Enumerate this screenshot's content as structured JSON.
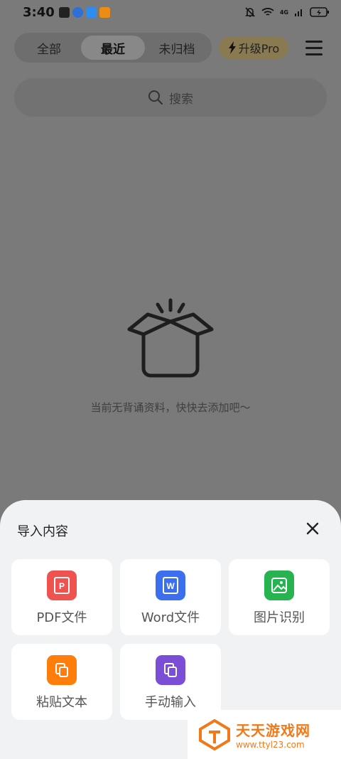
{
  "status_bar": {
    "time": "3:40",
    "network": "4G",
    "icons": [
      "qq-icon",
      "location-icon",
      "cloud-icon",
      "video-app-icon",
      "mute-bell-icon",
      "wifi-icon",
      "signal-icon",
      "battery-icon"
    ]
  },
  "tabs": [
    {
      "label": "全部",
      "active": false
    },
    {
      "label": "最近",
      "active": true
    },
    {
      "label": "未归档",
      "active": false
    }
  ],
  "upgrade_label": "升级Pro",
  "search": {
    "placeholder": "搜索"
  },
  "empty_state": {
    "message": "当前无背诵资料，快快去添加吧～"
  },
  "sheet": {
    "title": "导入内容",
    "options": [
      {
        "label": "PDF文件",
        "icon": "pdf-icon",
        "color": "#ef5350"
      },
      {
        "label": "Word文件",
        "icon": "word-icon",
        "color": "#3b6ff0"
      },
      {
        "label": "图片识别",
        "icon": "image-icon",
        "color": "#27b34f"
      },
      {
        "label": "粘贴文本",
        "icon": "paste-icon",
        "color": "#ff7d0a"
      },
      {
        "label": "手动输入",
        "icon": "copy-icon",
        "color": "#7a4fd6"
      }
    ]
  },
  "watermark": {
    "title": "天天游戏网",
    "url": "www.ttyl23.com",
    "color": "#f07a1a"
  }
}
